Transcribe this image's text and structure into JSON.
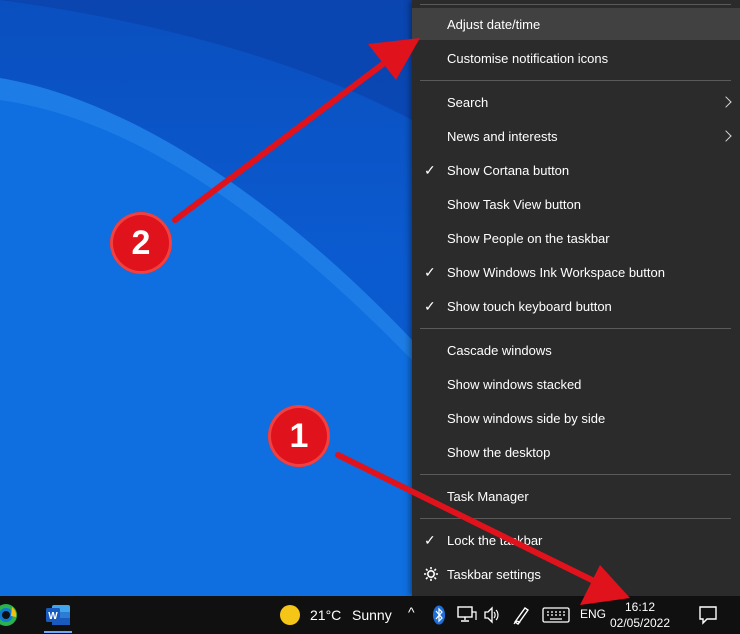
{
  "menu": {
    "items": [
      {
        "label": "Adjust date/time",
        "checked": false,
        "submenu": false,
        "highlighted": true
      },
      {
        "label": "Customise notification icons",
        "checked": false,
        "submenu": false
      },
      {
        "label": "Search",
        "checked": false,
        "submenu": true
      },
      {
        "label": "News and interests",
        "checked": false,
        "submenu": true
      },
      {
        "label": "Show Cortana button",
        "checked": true,
        "submenu": false
      },
      {
        "label": "Show Task View button",
        "checked": false,
        "submenu": false
      },
      {
        "label": "Show People on the taskbar",
        "checked": false,
        "submenu": false
      },
      {
        "label": "Show Windows Ink Workspace button",
        "checked": true,
        "submenu": false
      },
      {
        "label": "Show touch keyboard button",
        "checked": true,
        "submenu": false
      },
      {
        "label": "Cascade windows",
        "checked": false,
        "submenu": false
      },
      {
        "label": "Show windows stacked",
        "checked": false,
        "submenu": false
      },
      {
        "label": "Show windows side by side",
        "checked": false,
        "submenu": false
      },
      {
        "label": "Show the desktop",
        "checked": false,
        "submenu": false
      },
      {
        "label": "Task Manager",
        "checked": false,
        "submenu": false
      },
      {
        "label": "Lock the taskbar",
        "checked": true,
        "submenu": false
      },
      {
        "label": "Taskbar settings",
        "checked": false,
        "submenu": false,
        "icon": "gear-icon"
      }
    ]
  },
  "taskbar": {
    "weather_temp": "21°C",
    "weather_cond": "Sunny",
    "language": "ENG",
    "time": "16:12",
    "date": "02/05/2022"
  },
  "annotations": {
    "badge1": "1",
    "badge2": "2"
  },
  "colors": {
    "menu_bg": "#2b2b2b",
    "highlight": "#414141",
    "annotation_red": "#e0121b",
    "desktop_blue": "#0b5bd0"
  }
}
